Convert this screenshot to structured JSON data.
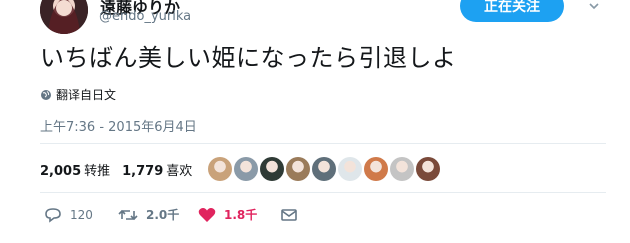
{
  "user": {
    "display_name": "遠藤ゆりか",
    "handle": "@endo_yurika"
  },
  "follow_button": {
    "label": "正在关注"
  },
  "tweet": {
    "text": "いちばん美しい姫になったら引退しよ",
    "translate_label": "翻译自日文",
    "timestamp": "上午7:36 - 2015年6月4日"
  },
  "stats": {
    "retweets_count": "2,005",
    "retweets_label": "转推",
    "likes_count": "1,779",
    "likes_label": "喜欢"
  },
  "likers": [
    {
      "color": "#c9a27a"
    },
    {
      "color": "#8a9aa8"
    },
    {
      "color": "#2f3b36"
    },
    {
      "color": "#9a7b5a"
    },
    {
      "color": "#5f6f7a"
    },
    {
      "color": "#dfe6ea"
    },
    {
      "color": "#d07a4a"
    },
    {
      "color": "#c4c4c4"
    },
    {
      "color": "#7a4a3a"
    }
  ],
  "actions": {
    "reply_count": "120",
    "retweet_count": "2.0千",
    "like_count": "1.8千"
  },
  "colors": {
    "accent": "#1da1f2",
    "like": "#e0245e",
    "muted": "#657786"
  }
}
